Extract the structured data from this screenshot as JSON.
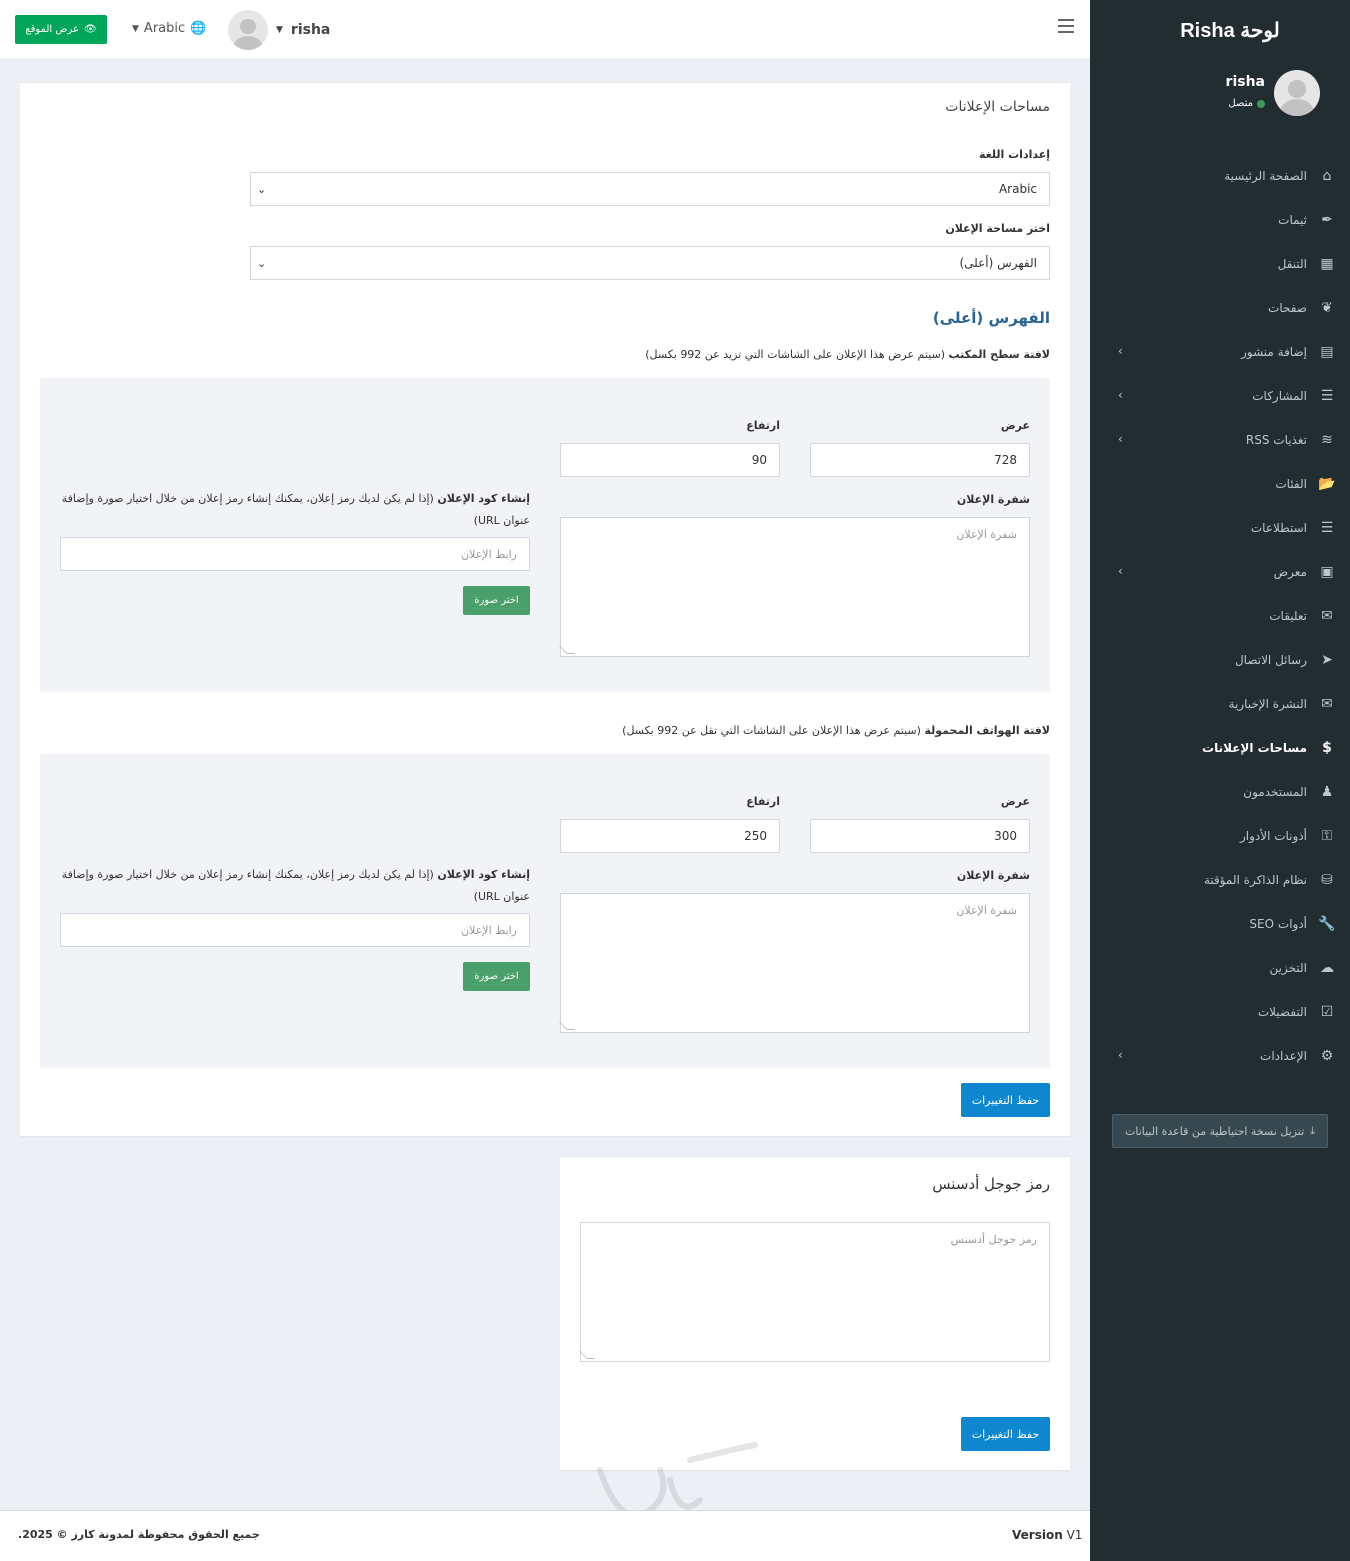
{
  "header": {
    "view_site_label": "عرض الموقع",
    "language": "Arabic",
    "username": "risha"
  },
  "sidebar": {
    "brand": "لوحة Risha",
    "user_name": "risha",
    "status": "متصل",
    "items": [
      {
        "label": "الصفحة الرئيسية",
        "icon": "home-icon"
      },
      {
        "label": "ثيمات",
        "icon": "brush-icon"
      },
      {
        "label": "التنقل",
        "icon": "grid-icon"
      },
      {
        "label": "صفحات",
        "icon": "leaf-icon"
      },
      {
        "label": "إضافة منشور",
        "icon": "file-icon"
      },
      {
        "label": "المشاركات",
        "icon": "list-icon"
      },
      {
        "label": "تغذيات RSS",
        "icon": "rss-icon"
      },
      {
        "label": "الفئات",
        "icon": "folder-icon"
      },
      {
        "label": "استطلاعات",
        "icon": "poll-icon"
      },
      {
        "label": "معرض",
        "icon": "image-icon"
      },
      {
        "label": "تعليقات",
        "icon": "comments-icon"
      },
      {
        "label": "رسائل الاتصال",
        "icon": "paper-plane-icon"
      },
      {
        "label": "النشرة الإخبارية",
        "icon": "envelope-icon"
      },
      {
        "label": "مساحات الإعلانات",
        "icon": "dollar-icon"
      },
      {
        "label": "المستخدمون",
        "icon": "users-icon"
      },
      {
        "label": "أذونات الأدوار",
        "icon": "key-icon"
      },
      {
        "label": "نظام الذاكرة المؤقتة",
        "icon": "database-icon"
      },
      {
        "label": "أدوات SEO",
        "icon": "wrench-icon"
      },
      {
        "label": "التخزين",
        "icon": "cloud-upload-icon"
      },
      {
        "label": "التفضيلات",
        "icon": "check-square-icon"
      },
      {
        "label": "الإعدادات",
        "icon": "cogs-icon"
      }
    ],
    "backup_label": "تنزيل نسخة احتياطية من قاعدة البيانات"
  },
  "ads": {
    "title": "مساحات الإعلانات",
    "language_settings_label": "إعدادات اللغة",
    "language_value": "Arabic",
    "select_space_label": "اختر مساحة الإعلان",
    "space_value": "الفهرس (أعلى)",
    "section_title": "الفهرس (أعلى)",
    "desktop": {
      "title": "لافتة سطح المكتب",
      "hint": "(سيتم عرض هذا الإعلان على الشاشات التي تزيد عن 992 بكسل)",
      "width_label": "عرض",
      "width_value": "728",
      "height_label": "ارتفاع",
      "height_value": "90",
      "code_label": "شفرة الإعلان",
      "code_placeholder": "شفرة الإعلان",
      "create_title": "إنشاء كود الإعلان",
      "create_hint": "(إذا لم يكن لديك رمز إعلان، يمكنك إنشاء رمز إعلان من خلال اختيار صورة وإضافة عنوان URL)",
      "url_placeholder": "رابط الإعلان",
      "choose_image": "اختر صورة"
    },
    "mobile": {
      "title": "لافتة الهواتف المحمولة",
      "hint": "(سيتم عرض هذا الإعلان على الشاشات التي تقل عن 992 بكسل)",
      "width_label": "عرض",
      "width_value": "300",
      "height_label": "ارتفاع",
      "height_value": "250",
      "code_label": "شفرة الإعلان",
      "code_placeholder": "شفرة الإعلان",
      "create_title": "إنشاء كود الإعلان",
      "create_hint": "(إذا لم يكن لديك رمز إعلان، يمكنك إنشاء رمز إعلان من خلال اختيار صورة وإضافة عنوان URL)",
      "url_placeholder": "رابط الإعلان",
      "choose_image": "اختر صورة"
    },
    "save_label": "حفظ التغييرات"
  },
  "adsense": {
    "title": "رمز جوجل أدسنس",
    "placeholder": "رمز جوجل أدسنس",
    "save_label": "حفظ التغييرات"
  },
  "footer": {
    "copyright": "جميع الحقوق محفوظة لمدونة كارز © 2025.",
    "version_label": "Version",
    "version_value": "V1"
  },
  "colors": {
    "sidebar_bg": "#222d32",
    "primary": "#0e87cf",
    "success": "#00a65a",
    "section_title": "#2a6496"
  }
}
